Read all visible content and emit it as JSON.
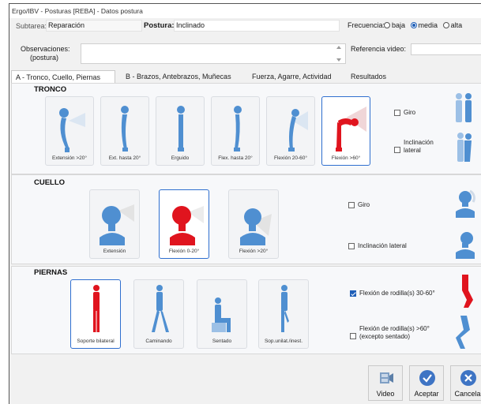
{
  "window": {
    "title": "Ergo/IBV - Posturas [REBA] - Datos postura"
  },
  "header": {
    "subtarea_label": "Subtarea:",
    "subtarea_value": "Reparación",
    "postura_label": "Postura:",
    "postura_value": "Inclinado",
    "frecuencia_label": "Frecuencia:",
    "freq_options": [
      "baja",
      "media",
      "alta"
    ],
    "freq_selected": "media",
    "obs_label_1": "Observaciones:",
    "obs_label_2": "(postura)",
    "obs_value": "",
    "ref_label": "Referencia video:",
    "ref_value": ""
  },
  "tabs": [
    {
      "label": "A - Tronco, Cuello, Piernas",
      "active": true
    },
    {
      "label": "B - Brazos, Antebrazos, Muñecas",
      "active": false
    },
    {
      "label": "Fuerza, Agarre, Actividad",
      "active": false
    },
    {
      "label": "Resultados",
      "active": false
    }
  ],
  "tronco": {
    "title": "TRONCO",
    "options": [
      "Extensión >20°",
      "Ext. hasta 20°",
      "Erguido",
      "Flex. hasta 20°",
      "Flexión 20-60°",
      "Flexión >60°"
    ],
    "selected": "Flexión >60°",
    "checks": [
      {
        "label": "Giro",
        "checked": false
      },
      {
        "label": "Inclinación lateral",
        "label_1": "Inclinación",
        "label_2": "lateral",
        "checked": false
      }
    ]
  },
  "cuello": {
    "title": "CUELLO",
    "options": [
      "Extensión",
      "Flexión 0-20°",
      "Flexión >20°"
    ],
    "selected": "Flexión 0-20°",
    "checks": [
      {
        "label": "Giro",
        "checked": false
      },
      {
        "label": "Inclinación lateral",
        "checked": false
      }
    ]
  },
  "piernas": {
    "title": "PIERNAS",
    "options": [
      "Soporte bilateral",
      "Caminando",
      "Sentado",
      "Sop.unilat./inest."
    ],
    "selected": "Soporte bilateral",
    "checks": [
      {
        "label": "Flexión de rodilla(s) 30-60°",
        "checked": true
      },
      {
        "label_1": "Flexión de rodilla(s) >60°",
        "label_2": "(excepto sentado)",
        "checked": false
      }
    ]
  },
  "footer": {
    "video_label": "Video",
    "aceptar_label": "Aceptar",
    "cancelar_label": "Cancela"
  },
  "colors": {
    "selected_figure": "#e0141e",
    "figure": "#4f8fd1",
    "accent": "#1f5fb8"
  }
}
